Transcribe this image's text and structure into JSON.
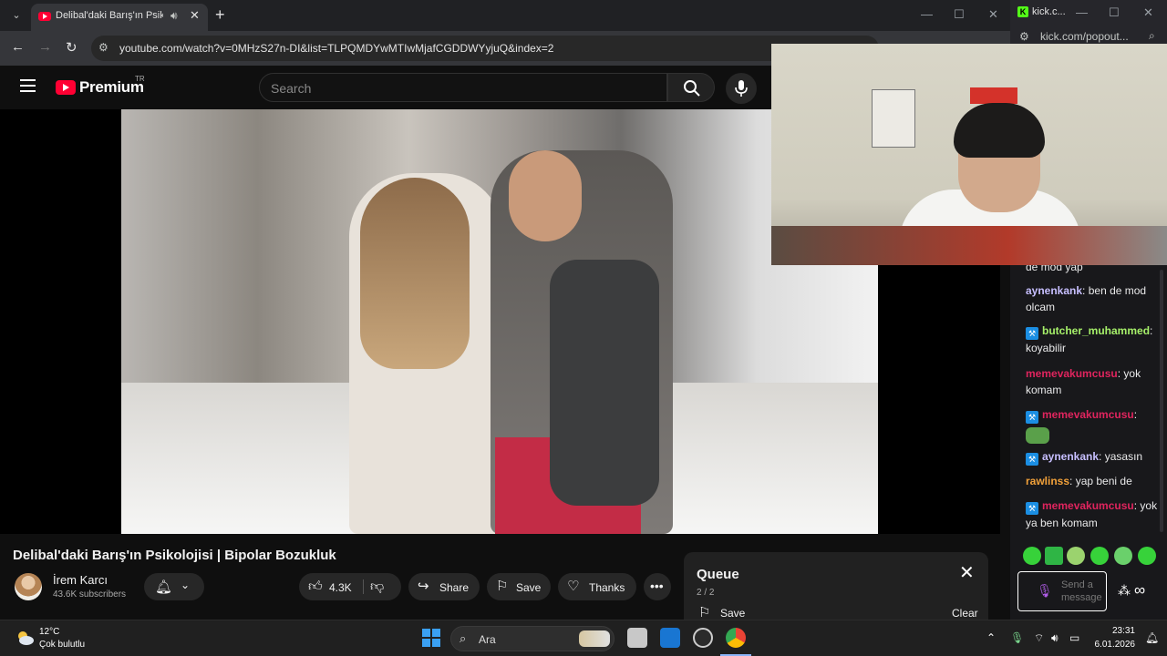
{
  "chrome": {
    "tab_title": "Delibal'daki Barış'ın Psikoloj",
    "url": "youtube.com/watch?v=0MHzS27n-DI&list=TLPQMDYwMTIwMjafCGDDWYyjuQ&index=2"
  },
  "youtube": {
    "brand": "Premium",
    "region": "TR",
    "search_placeholder": "Search",
    "video_title": "Delibal'daki Barış'ın Psikolojisi | Bipolar Bozukluk",
    "channel_name": "İrem Karcı",
    "subscribers": "43.6K subscribers",
    "likes": "4.3K",
    "share_label": "Share",
    "save_label": "Save",
    "thanks_label": "Thanks",
    "queue": {
      "title": "Queue",
      "count": "2 / 2",
      "save_label": "Save",
      "clear_label": "Clear"
    }
  },
  "kick": {
    "window_title": "kick.c...",
    "url": "kick.com/popout...",
    "chat": [
      {
        "user": "",
        "text": "de mod yap",
        "color": "plain",
        "badge": false
      },
      {
        "user": "aynenkank",
        "text": "ben de mod olcam",
        "color": "purple",
        "badge": false
      },
      {
        "user": "butcher_muhammed",
        "text": ": koyabilir",
        "color": "green",
        "badge": true
      },
      {
        "user": "memevakumcusu",
        "text": "yok komam",
        "color": "red",
        "badge": false
      },
      {
        "user": "memevakumcusu",
        "text": "",
        "color": "red",
        "badge": true
      },
      {
        "user": "aynenkank",
        "text": "yasasın",
        "color": "purple",
        "badge": true
      },
      {
        "user": "rawlinss",
        "text": "yap beni de",
        "color": "orange",
        "badge": false
      },
      {
        "user": "memevakumcusu",
        "text": "yok ya ben komam",
        "color": "red",
        "badge": true
      }
    ],
    "chat_placeholder": "Send a message"
  },
  "taskbar": {
    "temperature": "12°C",
    "weather": "Çok bulutlu",
    "search_label": "Ara",
    "time": "23:31",
    "date": "6.01.2026"
  },
  "colors": {
    "yt_red": "#ff0033",
    "kick_green": "#53fc18",
    "chrome_bg": "#202124"
  }
}
